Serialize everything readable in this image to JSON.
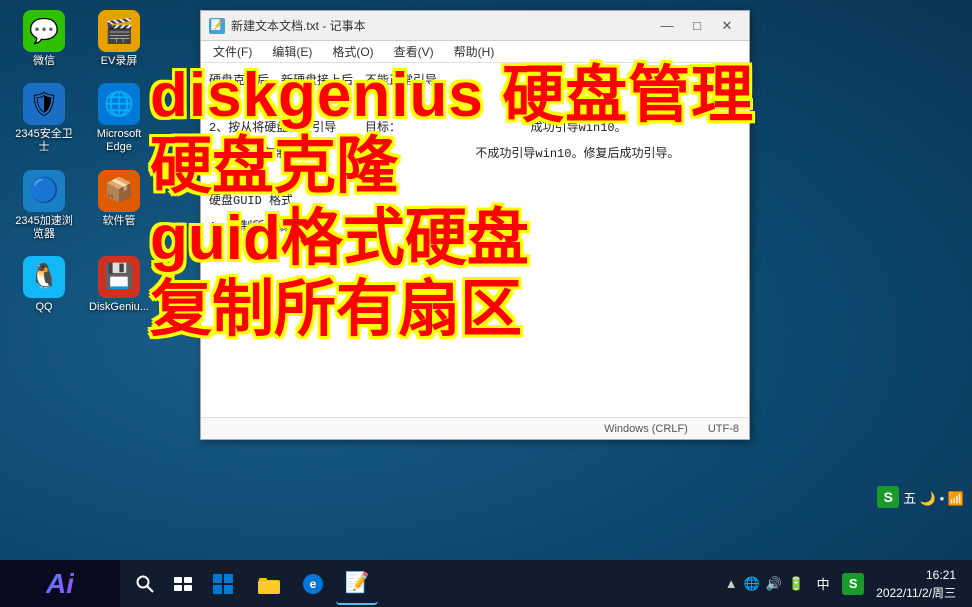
{
  "desktop": {
    "icons": [
      {
        "id": "wechat",
        "emoji": "💬",
        "label": "微信",
        "bg": "#2dc100"
      },
      {
        "id": "ev-recorder",
        "emoji": "📹",
        "label": "EV录屏",
        "bg": "#e8a000"
      },
      {
        "id": "security",
        "emoji": "🛡",
        "label": "2345安全卫士",
        "bg": "#1a6fc4"
      },
      {
        "id": "edge",
        "emoji": "🌐",
        "label": "Microsoft Edge",
        "bg": "#0078d7"
      },
      {
        "id": "ie",
        "emoji": "🔵",
        "label": "2345加速浏览器",
        "bg": "#1a80c4"
      },
      {
        "id": "software-mgr",
        "emoji": "📦",
        "label": "软件管",
        "bg": "#e05a00"
      },
      {
        "id": "qq",
        "emoji": "🐧",
        "label": "QQ",
        "bg": "#12b7f5"
      },
      {
        "id": "diskgenius",
        "emoji": "💾",
        "label": "DiskGeniu...",
        "bg": "#d03020"
      }
    ]
  },
  "notepad": {
    "title": "新建文本文档.txt - 记事本",
    "menu": [
      "文件(F)",
      "编辑(E)",
      "格式(O)",
      "查看(V)",
      "帮助(H)"
    ],
    "content": [
      "硬盘克隆后，新硬盘接上后，不能正常引导。",
      "",
      "2、按从将硬盘修复引导   目标：                    成功引导win10。",
      "3、按文件复制                                    不成功引导win10。修复后成功引导。",
      "",
      "硬盘GUID 格式",
      "1、复制所有扇区"
    ],
    "statusbar": {
      "lineinfo": "Windows (CRLF)",
      "encoding": "UTF-8"
    },
    "controls": {
      "minimize": "—",
      "maximize": "□",
      "close": "✕"
    }
  },
  "overlay": {
    "line1": "diskgenius 硬盘管理",
    "line2": "硬盘克隆",
    "line3": "guid格式硬盘",
    "line4": "复制所有扇区"
  },
  "taskbar": {
    "search_placeholder": "搜索",
    "apps": [
      {
        "id": "explorer",
        "emoji": "📁"
      },
      {
        "id": "edge",
        "emoji": "🌐"
      },
      {
        "id": "windows",
        "emoji": "⊞"
      },
      {
        "id": "store",
        "emoji": "🛍"
      }
    ],
    "tray": {
      "icons": [
        "▲",
        "🌐",
        "🔊",
        "🔋"
      ],
      "language": "中",
      "s_logo": "S",
      "time": "16:21",
      "date": "2022/11/2/周三"
    }
  },
  "ai_badge": {
    "text": "Ai"
  },
  "banner": {
    "items": [
      "S",
      "五",
      "🌙",
      "•",
      "📶"
    ]
  }
}
